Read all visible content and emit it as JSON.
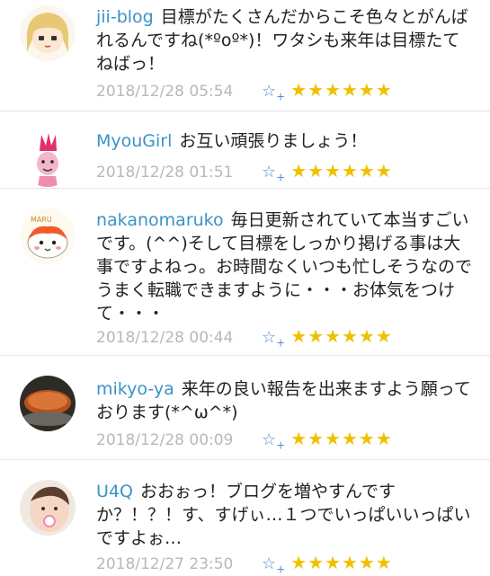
{
  "comments": [
    {
      "user": "jii-blog",
      "text": "目標がたくさんだからこそ色々とがんばれるんですね(*ºoº*)！ワタシも来年は目標たてねばっ！",
      "date": "2018/12/28 05:54",
      "stars": "★★★★★★",
      "avatar": "blonde-girl-avatar"
    },
    {
      "user": "MyouGirl",
      "text": "お互い頑張りましょう！",
      "date": "2018/12/28 01:51",
      "stars": "★★★★★★",
      "avatar": "pink-hair-avatar"
    },
    {
      "user": "nakanomaruko",
      "text": "毎日更新されていて本当すごいです。(^^)そして目標をしっかり掲げる事は大事ですよねっ。お時間なくいつも忙しそうなのでうまく転職できますように・・・お体気をつけて・・・",
      "date": "2018/12/28 00:44",
      "stars": "★★★★★★",
      "avatar": "maru-character-avatar",
      "avatar_label": "MARU"
    },
    {
      "user": "mikyo-ya",
      "text": "来年の良い報告を出来ますよう願っております(*^ω^*)",
      "date": "2018/12/28 00:09",
      "stars": "★★★★★★",
      "avatar": "food-photo-avatar"
    },
    {
      "user": "U4Q",
      "text": "おおぉっ！ブログを増やすんですか？！？！す、すげぃ…１つでいっぱいいっぱいですよぉ…",
      "date": "2018/12/27 23:50",
      "stars": "★★★★★★",
      "avatar": "baby-photo-avatar"
    }
  ],
  "star_add_glyph": "☆",
  "star_add_plus": "+",
  "colors": {
    "username": "#3a93c6",
    "star": "#f0c000",
    "date": "#b8b8b8"
  }
}
